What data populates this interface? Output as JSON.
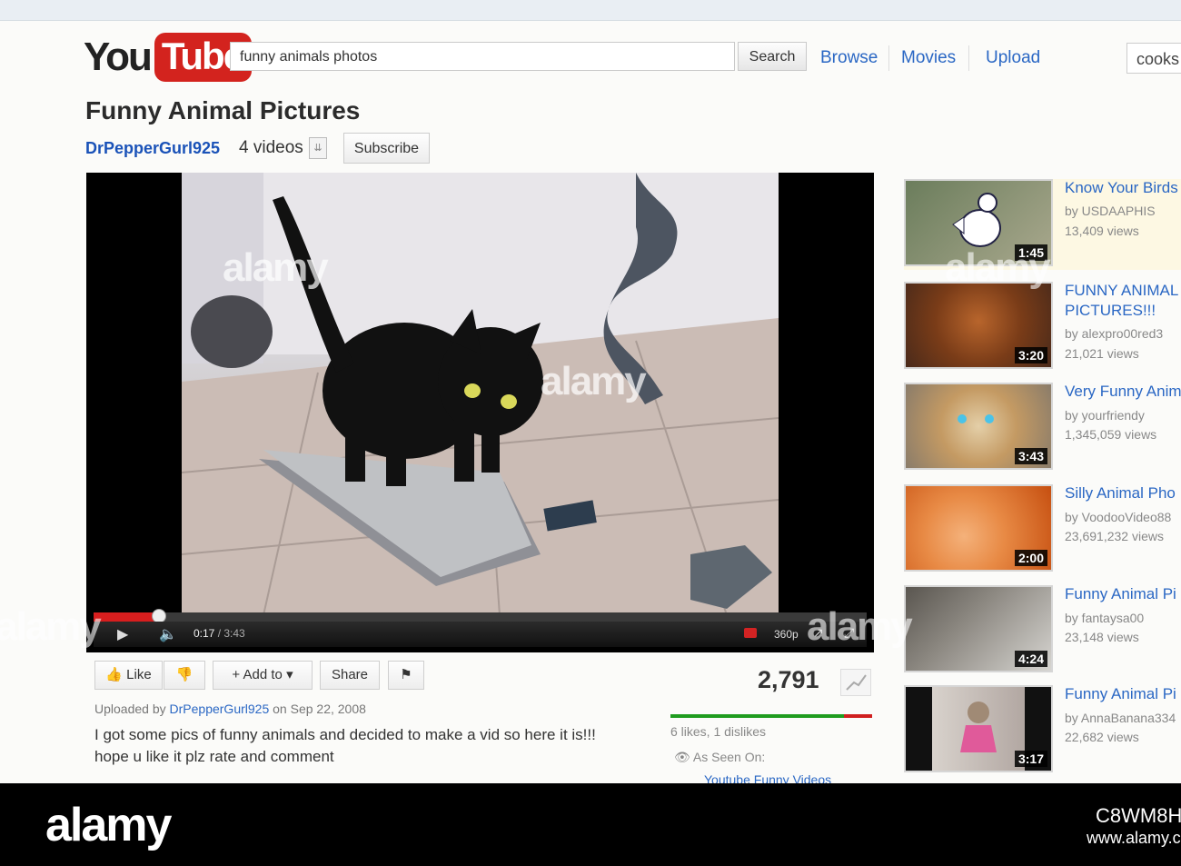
{
  "header": {
    "logo_you": "You",
    "logo_tube": "Tube",
    "search_value": "funny animals photos",
    "search_button": "Search",
    "nav": [
      "Browse",
      "Movies",
      "Upload"
    ],
    "user": "cooks"
  },
  "video": {
    "title": "Funny Animal Pictures",
    "channel": "DrPepperGurl925",
    "video_count": "4 videos",
    "subscribe": "Subscribe",
    "current_time": "0:17",
    "duration": "/ 3:43",
    "quality": "360p",
    "progress_fraction": 0.085,
    "watermark": "alamy"
  },
  "actions": {
    "like": "Like",
    "add_to": "Add to",
    "share": "Share",
    "views": "2,791",
    "likes_text": "6 likes, 1 dislikes",
    "like_fraction": 0.86
  },
  "info": {
    "uploaded_prefix": "Uploaded by",
    "uploader": "DrPepperGurl925",
    "date": "on Sep 22, 2008",
    "desc_line1": "I got some pics of funny animals and decided to make a vid so here it is!!!",
    "desc_line2": "hope u like it plz rate and comment",
    "as_seen_on": "As Seen On:",
    "as_seen_link": "Youtube Funny Videos"
  },
  "sidebar": {
    "items": [
      {
        "title": "Know Your Birds",
        "title2": "",
        "by": "by USDAAPHIS",
        "views": "13,409 views",
        "duration": "1:45"
      },
      {
        "title": "FUNNY ANIMAL",
        "title2": "PICTURES!!!",
        "by": "by alexpro00red3",
        "views": "21,021 views",
        "duration": "3:20"
      },
      {
        "title": "Very Funny Anim",
        "title2": "",
        "by": "by yourfriendy",
        "views": "1,345,059 views",
        "duration": "3:43"
      },
      {
        "title": "Silly Animal Pho",
        "title2": "",
        "by": "by VoodooVideo88",
        "views": "23,691,232 views",
        "duration": "2:00"
      },
      {
        "title": "Funny Animal Pi",
        "title2": "",
        "by": "by fantaysa00",
        "views": "23,148 views",
        "duration": "4:24"
      },
      {
        "title": "Funny Animal Pi",
        "title2": "",
        "by": "by AnnaBanana334",
        "views": "22,682 views",
        "duration": "3:17"
      }
    ]
  },
  "watermark": {
    "brand": "alamy",
    "code": "C8WM8H",
    "url": "www.alamy.com"
  }
}
